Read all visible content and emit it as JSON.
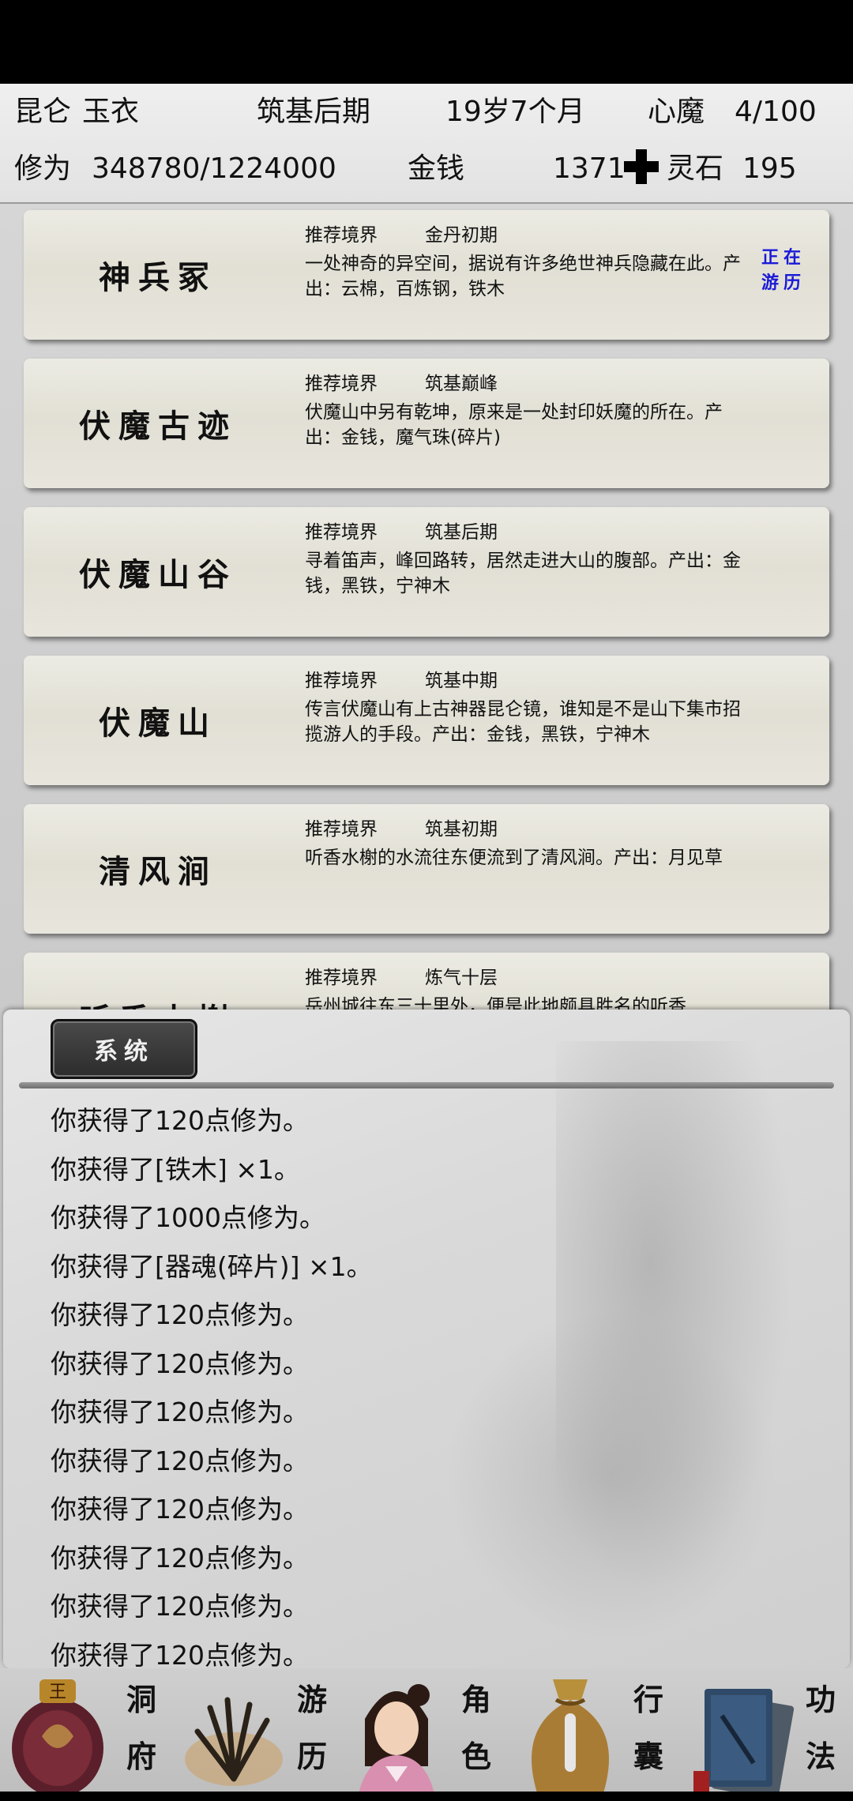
{
  "header": {
    "sect": "昆仑",
    "name": "玉衣",
    "realm": "筑基后期",
    "age": "19岁7个月",
    "demon_label": "心魔",
    "demon_value": "4/100",
    "cultivation_label": "修为",
    "cultivation_value": "348780/1224000",
    "money_label": "金钱",
    "money_value": "1371",
    "add_icon": "plus-icon",
    "stone_label": "灵石",
    "stone_value": "195"
  },
  "locations": [
    {
      "title": "神兵冢",
      "realm_label": "推荐境界",
      "realm_value": "金丹初期",
      "desc": "一处神奇的异空间，据说有许多绝世神兵隐藏在此。产出：云棉，百炼钢，铁木",
      "badge": "正在游历"
    },
    {
      "title": "伏魔古迹",
      "realm_label": "推荐境界",
      "realm_value": "筑基巅峰",
      "desc": "伏魔山中另有乾坤，原来是一处封印妖魔的所在。产出：金钱，魔气珠(碎片)"
    },
    {
      "title": "伏魔山谷",
      "realm_label": "推荐境界",
      "realm_value": "筑基后期",
      "desc": "寻着笛声，峰回路转，居然走进大山的腹部。产出：金钱，黑铁，宁神木"
    },
    {
      "title": "伏魔山",
      "realm_label": "推荐境界",
      "realm_value": "筑基中期",
      "desc": "传言伏魔山有上古神器昆仑镜，谁知是不是山下集市招揽游人的手段。产出：金钱，黑铁，宁神木"
    },
    {
      "title": "清风涧",
      "realm_label": "推荐境界",
      "realm_value": "筑基初期",
      "desc": "听香水榭的水流往东便流到了清风涧。产出：月见草"
    },
    {
      "title": "听香水榭",
      "realm_label": "推荐境界",
      "realm_value": "炼气十层",
      "desc": "岳州城往东三十里外，便是此地颇具胜名的听香"
    }
  ],
  "system": {
    "tab_label": "系统",
    "log": [
      "你获得了120点修为。",
      "你获得了[铁木] ×1。",
      "你获得了1000点修为。",
      "你获得了[器魂(碎片)] ×1。",
      "你获得了120点修为。",
      "你获得了120点修为。",
      "你获得了120点修为。",
      "你获得了120点修为。",
      "你获得了120点修为。",
      "你获得了120点修为。",
      "你获得了120点修为。",
      "你获得了120点修为。"
    ]
  },
  "nav": {
    "cave": {
      "l1": "洞",
      "l2": "府",
      "icon": "cauldron-icon"
    },
    "travel": {
      "l1": "游",
      "l2": "历",
      "icon": "grass-tuft-icon"
    },
    "character": {
      "l1": "角",
      "l2": "色",
      "icon": "character-portrait-icon"
    },
    "bag": {
      "l1": "行",
      "l2": "囊",
      "icon": "bag-icon"
    },
    "skills": {
      "l1": "功",
      "l2": "法",
      "icon": "scroll-books-icon"
    }
  },
  "colors": {
    "badge": "#1a1ad8",
    "topbar": "#000000",
    "tab_bg": "#3a3a3a"
  }
}
